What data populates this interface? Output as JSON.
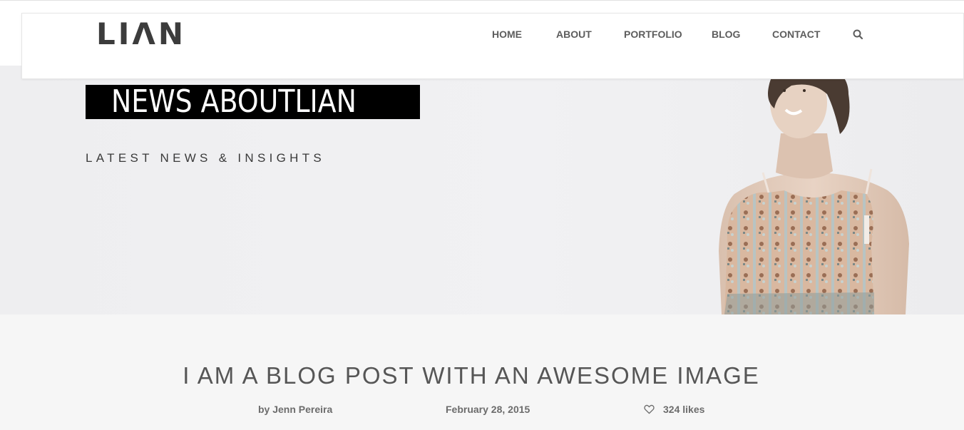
{
  "header": {
    "logo": "LIΛN",
    "nav": [
      {
        "label": "HOME"
      },
      {
        "label": "ABOUT"
      },
      {
        "label": "PORTFOLIO"
      },
      {
        "label": "BLOG"
      },
      {
        "label": "CONTACT"
      }
    ],
    "search_icon": "search-icon"
  },
  "hero": {
    "title": "NEWS ABOUTLIAN",
    "subtitle": "LATEST NEWS & INSIGHTS"
  },
  "post": {
    "title": "I AM A BLOG POST WITH AN AWESOME IMAGE",
    "author": "by Jenn Pereira",
    "date": "February 28, 2015",
    "likes": "324 likes",
    "likes_icon": "heart-icon"
  },
  "colors": {
    "title_box": "#000000",
    "nav_text": "#5d5d5d",
    "page_bg": "#f6f6f6"
  }
}
